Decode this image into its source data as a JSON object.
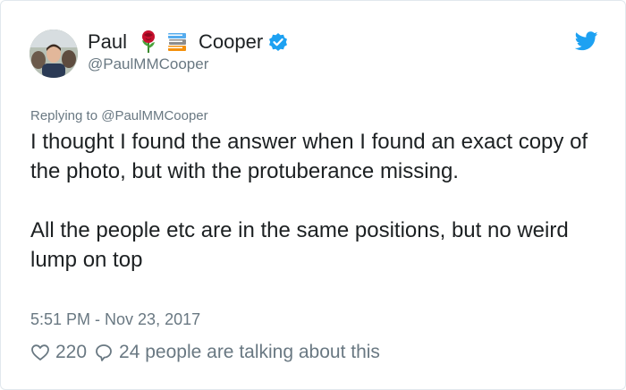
{
  "author": {
    "first_name": "Paul",
    "last_name": "Cooper",
    "emojis": [
      "rose",
      "books"
    ],
    "verified": true,
    "handle": "@PaulMMCooper"
  },
  "tweet": {
    "reply_label": "Replying to @PaulMMCooper",
    "paragraphs": [
      "I thought I found the answer when I found an exact copy of the photo, but with the protuberance missing.",
      "All the people etc are in the same positions, but no weird lump on top"
    ],
    "timestamp": "5:51 PM - Nov 23, 2017"
  },
  "stats": {
    "likes": "220",
    "talking": "24 people are talking about this"
  },
  "colors": {
    "twitter_blue": "#1da1f2",
    "muted_text": "#697882",
    "body_text": "#1c2022"
  }
}
